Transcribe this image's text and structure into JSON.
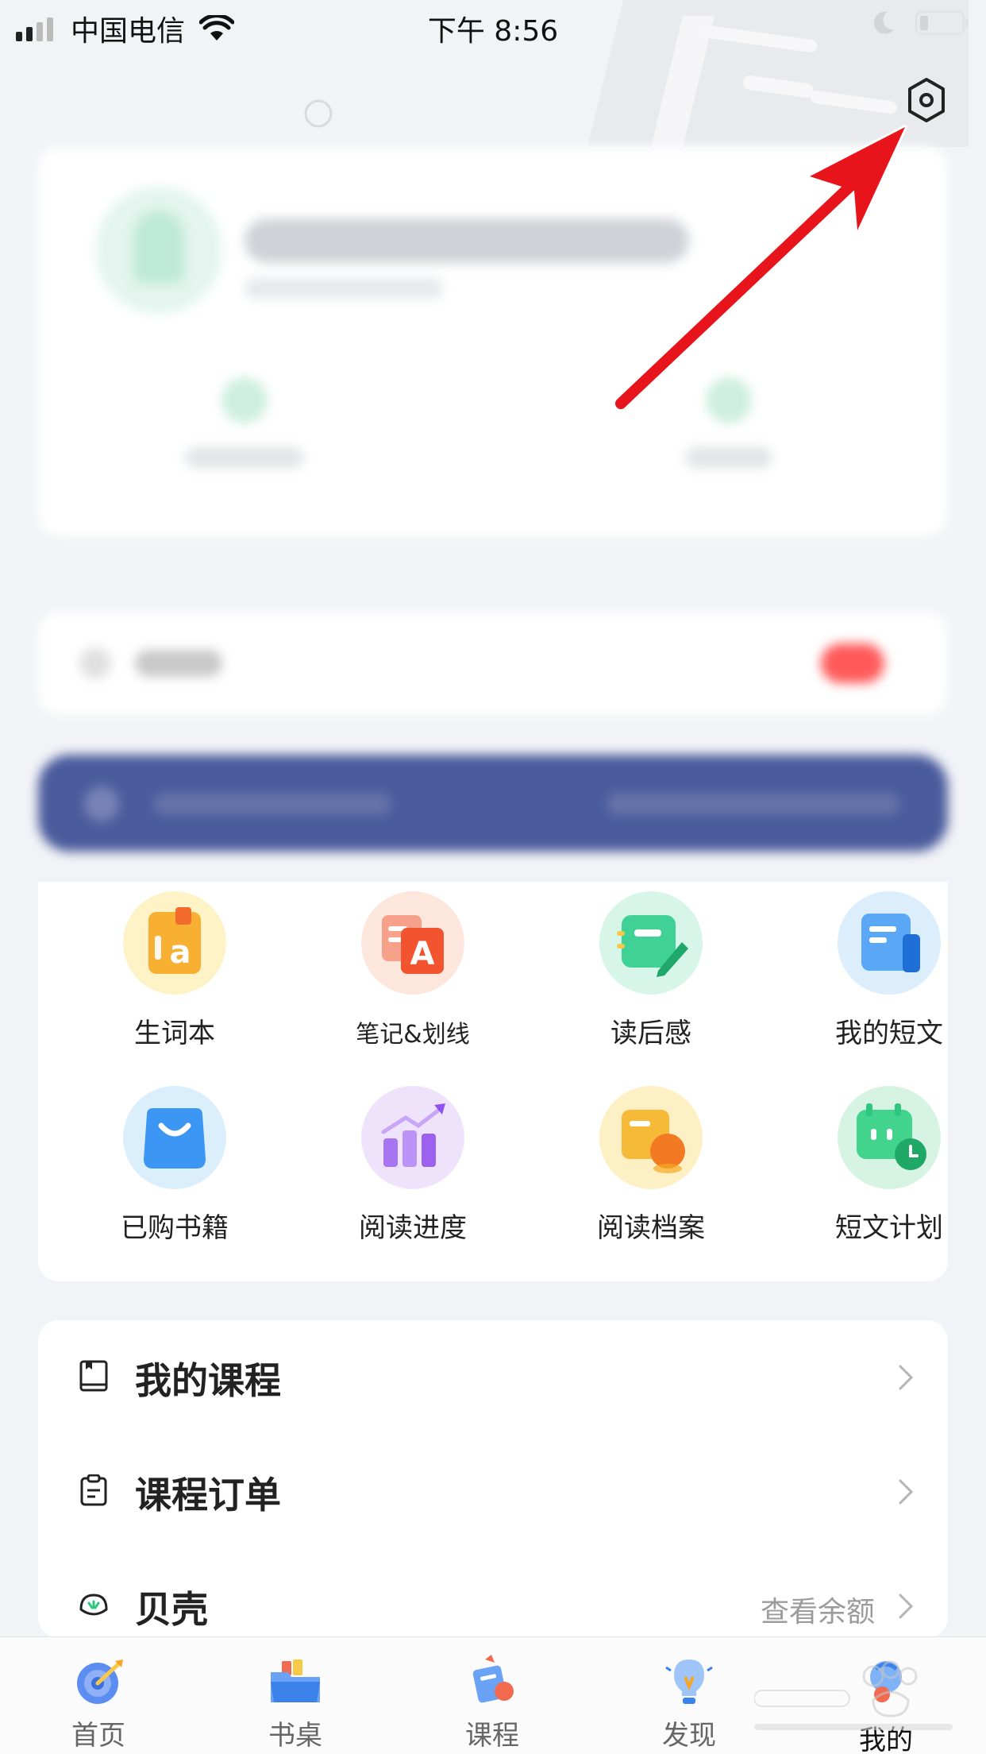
{
  "status_bar": {
    "carrier": "中国电信",
    "time": "下午 8:56"
  },
  "features": [
    {
      "label": "生词本",
      "icon": "vocabulary-book-icon",
      "bg": "#fdf3c6",
      "accent": "#f7b032"
    },
    {
      "label": "笔记&划线",
      "icon": "notes-highlight-icon",
      "bg": "#fde7dc",
      "accent": "#f26a4f"
    },
    {
      "label": "读后感",
      "icon": "reflection-note-icon",
      "bg": "#d7f5e8",
      "accent": "#34c98a"
    },
    {
      "label": "我的短文",
      "icon": "my-essay-icon",
      "bg": "#dcedfb",
      "accent": "#3b8ff0"
    },
    {
      "label": "已购书籍",
      "icon": "shopping-bag-icon",
      "bg": "#dbeefc",
      "accent": "#3a95f2"
    },
    {
      "label": "阅读进度",
      "icon": "reading-progress-icon",
      "bg": "#efe3fb",
      "accent": "#9b62f0"
    },
    {
      "label": "阅读档案",
      "icon": "reading-archive-icon",
      "bg": "#fdf0c4",
      "accent": "#f5a623"
    },
    {
      "label": "短文计划",
      "icon": "essay-plan-icon",
      "bg": "#d6f3e3",
      "accent": "#2ec77f"
    }
  ],
  "menu": {
    "my_courses": {
      "label": "我的课程",
      "icon": "book-outline-icon"
    },
    "course_orders": {
      "label": "课程订单",
      "icon": "clipboard-icon"
    },
    "shells": {
      "label": "贝壳",
      "hint": "查看余额",
      "icon": "shell-icon"
    }
  },
  "tabs": [
    {
      "label": "首页",
      "icon": "target-icon"
    },
    {
      "label": "书桌",
      "icon": "folder-icon"
    },
    {
      "label": "课程",
      "icon": "course-icon"
    },
    {
      "label": "发现",
      "icon": "lightbulb-icon"
    },
    {
      "label": "我的",
      "icon": "profile-icon"
    }
  ],
  "colors": {
    "page_bg": "#f2f3f7",
    "banner_blue": "#4a5b9c",
    "annotation_red": "#e8141c"
  }
}
